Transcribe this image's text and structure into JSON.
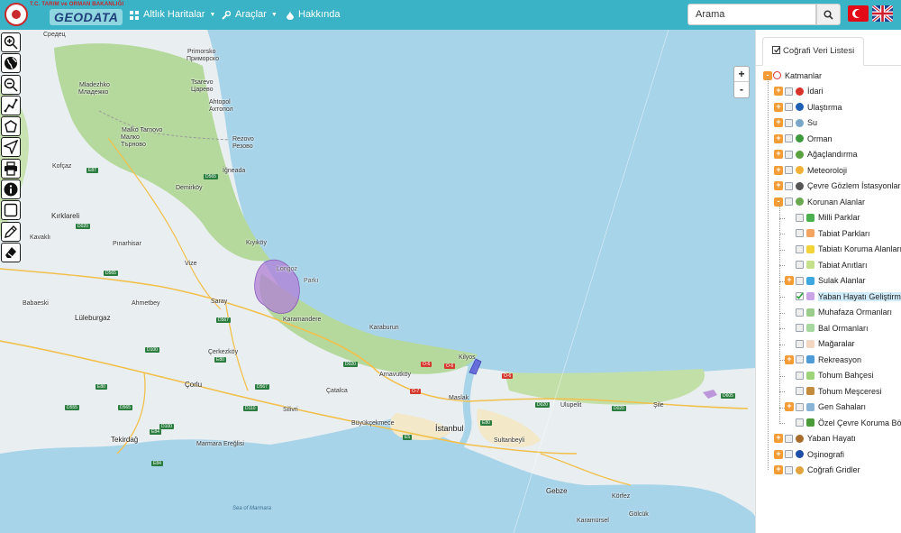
{
  "header": {
    "ministry": "T.C. TARIM ve ORMAN BAKANLIĞI",
    "brand": "GEODATA",
    "nav": [
      {
        "label": "Altlık Haritalar",
        "icon": "grid-icon"
      },
      {
        "label": "Araçlar",
        "icon": "wrench-icon"
      },
      {
        "label": "Hakkında",
        "icon": "drop-icon"
      }
    ],
    "search": {
      "value": "Arama"
    }
  },
  "map": {
    "colors": {
      "sea": "#a8d4ea",
      "land": "#e9eef0",
      "forest": "#b5d99c",
      "protected": "#b07fd6",
      "urban": "#f3e8c8"
    },
    "zoom_in": "+",
    "zoom_out": "-",
    "labels": {
      "sredec": "Средец",
      "primorsko_lat": "Primorsko",
      "primorsko_cyr": "Приморско",
      "mladezhko_lat": "Mladezhko",
      "mladezhko_cyr": "Младежко",
      "carevo_lat": "Tsarevo",
      "carevo_cyr": "Царево",
      "ahtopol_lat": "Ahtopol",
      "ahtopol_cyr": "Ахтопол",
      "malko_lat": "Malko Tarnovo",
      "malko_cyr1": "Малко",
      "malko_cyr2": "Търново",
      "rezovo_lat": "Rezovo",
      "rezovo_cyr": "Резово",
      "igneada": "İğneada",
      "demirkoy": "Demirköy",
      "kirklareli": "Kırklareli",
      "kavakli": "Kavaklı",
      "kofcaz": "Kofçaz",
      "pinarhisar": "Pınarhisar",
      "vize": "Vize",
      "kiyikoy": "Kıyıköy",
      "babaeski": "Babaeski",
      "ahmetbey": "Ahmetbey",
      "luleburgaz": "Lüleburgaz",
      "saray": "Saray",
      "karamandere": "Karamandere",
      "karaburun": "Karaburun",
      "cerkezkoy": "Çerkezköy",
      "corlu": "Çorlu",
      "catalca": "Çatalca",
      "arnavutkoy": "Arnavutköy",
      "kilyos": "Kilyos",
      "maslak": "Maslak",
      "silivri": "Silivri",
      "buyukcekmece": "Büyükçekmece",
      "istanbul": "İstanbul",
      "sultanbeyli": "Sultanbeyli",
      "ulupelit": "Ulupelit",
      "sile": "Şile",
      "tekirdag": "Tekirdağ",
      "marmara_ereglisi": "Marmara Ereğlisi",
      "gebze": "Gebze",
      "korfez": "Körfez",
      "golcuk": "Gölcük",
      "karamursel": "Karamürsel",
      "sea_of_marmara": "Sea of Marmara",
      "igneada_park": "Longoz",
      "park2": "Parkı"
    },
    "roads": [
      "E87",
      "D565",
      "D020",
      "D565",
      "D100",
      "D567",
      "E80",
      "D567",
      "D110",
      "D100",
      "E80",
      "D555",
      "D565",
      "E84",
      "E84",
      "O-6",
      "O-6",
      "O-7",
      "O-6",
      "D020",
      "D020",
      "D605",
      "E80",
      "E5",
      "D020"
    ]
  },
  "tools": [
    "zoom-in-icon",
    "globe-icon",
    "zoom-out-icon",
    "measure-line-icon",
    "measure-area-icon",
    "navigate-icon",
    "print-icon",
    "info-icon",
    "select-box-icon",
    "draw-pencil-icon",
    "eraser-icon"
  ],
  "panel": {
    "tab": "Coğrafi Veri Listesi",
    "root": "Katmanlar",
    "layers": [
      {
        "label": "İdari",
        "toggle": "+",
        "icon_color": "#d9342b"
      },
      {
        "label": "Ulaştırma",
        "toggle": "+",
        "icon_color": "#1e5fb3"
      },
      {
        "label": "Su",
        "toggle": "+",
        "icon_color": "#7aa7c7"
      },
      {
        "label": "Orman",
        "toggle": "+",
        "icon_color": "#3c9a3c"
      },
      {
        "label": "Ağaçlandırma",
        "toggle": "+",
        "icon_color": "#5aa23f"
      },
      {
        "label": "Meteoroloji",
        "toggle": "+",
        "icon_color": "#f2b134"
      },
      {
        "label": "Çevre Gözlem İstasyonları",
        "toggle": "+",
        "icon_color": "#555555"
      },
      {
        "label": "Korunan Alanlar",
        "toggle": "-",
        "icon_color": "#6aa84f"
      },
      {
        "label": "Milli Parklar",
        "toggle": "",
        "icon_color": "#4caf50"
      },
      {
        "label": "Tabiat Parkları",
        "toggle": "",
        "icon_color": "#f4a460"
      },
      {
        "label": "Tabiatı Koruma Alanları",
        "toggle": "",
        "icon_color": "#f0d43a"
      },
      {
        "label": "Tabiat Anıtları",
        "toggle": "",
        "icon_color": "#c5e08a"
      },
      {
        "label": "Sulak Alanlar",
        "toggle": "+",
        "icon_color": "#3fa7e0"
      },
      {
        "label": "Yaban Hayatı Geliştirme Sahaları",
        "toggle": "",
        "icon_color": "#c9a5e8",
        "checked": true
      },
      {
        "label": "Muhafaza Ormanları",
        "toggle": "",
        "icon_color": "#9ccc8c"
      },
      {
        "label": "Bal Ormanları",
        "toggle": "",
        "icon_color": "#a6d8a0"
      },
      {
        "label": "Mağaralar",
        "toggle": "",
        "icon_color": "#f4d7c0"
      },
      {
        "label": "Rekreasyon",
        "toggle": "+",
        "icon_color": "#4f9bd6"
      },
      {
        "label": "Tohum Bahçesi",
        "toggle": "",
        "icon_color": "#9dd47a"
      },
      {
        "label": "Tohum Meşceresi",
        "toggle": "",
        "icon_color": "#c38b3d"
      },
      {
        "label": "Gen Sahaları",
        "toggle": "+",
        "icon_color": "#8ab4d6"
      },
      {
        "label": "Özel Çevre Koruma Bölgeleri",
        "toggle": "",
        "icon_color": "#4c9b3a"
      },
      {
        "label": "Yaban Hayatı",
        "toggle": "+",
        "icon_color": "#a86d2c"
      },
      {
        "label": "Oşinografi",
        "toggle": "+",
        "icon_color": "#1e4fa8"
      },
      {
        "label": "Coğrafi Gridler",
        "toggle": "+",
        "icon_color": "#e2a33c"
      }
    ]
  }
}
